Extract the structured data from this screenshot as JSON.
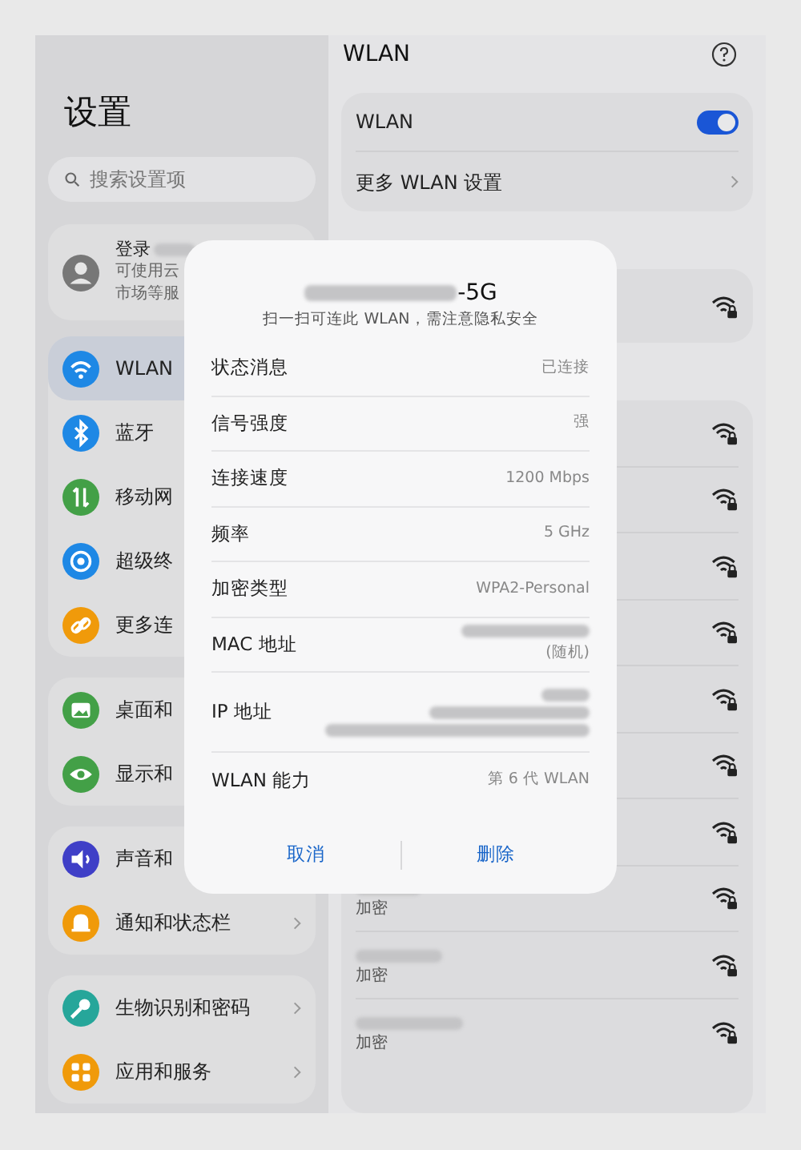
{
  "sidebar": {
    "title": "设置",
    "search": {
      "placeholder": "搜索设置项"
    },
    "account": {
      "title": "登录",
      "lines": [
        "可使用云",
        "市场等服"
      ]
    },
    "groups": [
      [
        {
          "label": "WLAN",
          "color": "#1e88e5",
          "selected": true
        },
        {
          "label": "蓝牙",
          "color": "#1e88e5",
          "selected": false
        },
        {
          "label": "移动网",
          "color": "#43a047",
          "selected": false
        },
        {
          "label": "超级终",
          "color": "#1e88e5",
          "selected": false
        },
        {
          "label": "更多连",
          "color": "#f09a0a",
          "selected": false
        }
      ],
      [
        {
          "label": "桌面和",
          "color": "#43a047",
          "selected": false
        },
        {
          "label": "显示和",
          "color": "#43a047",
          "selected": false
        }
      ],
      [
        {
          "label": "声音和",
          "color": "#3f3fc7",
          "selected": false
        },
        {
          "label": "通知和状态栏",
          "color": "#f09a0a",
          "selected": false,
          "chevron": true
        }
      ],
      [
        {
          "label": "生物识别和密码",
          "color": "#26a69a",
          "selected": false,
          "chevron": true
        },
        {
          "label": "应用和服务",
          "color": "#f09a0a",
          "selected": false,
          "chevron": true
        }
      ]
    ]
  },
  "main": {
    "title": "WLAN",
    "wlan_toggle": {
      "label": "WLAN",
      "on": true
    },
    "more_settings": "更多 WLAN 设置",
    "networks": [
      {
        "kind": "covered"
      },
      {
        "kind": "covered"
      },
      {
        "kind": "covered"
      },
      {
        "kind": "covered"
      },
      {
        "kind": "covered"
      },
      {
        "kind": "covered"
      },
      {
        "kind": "covered"
      },
      {
        "kind": "listed",
        "subtitle": "加密"
      },
      {
        "kind": "listed",
        "subtitle": "加密"
      },
      {
        "kind": "listed",
        "subtitle": "加密"
      }
    ]
  },
  "dialog": {
    "title": "-5G",
    "subtitle": "扫一扫可连此 WLAN，需注意隐私安全",
    "rows": [
      {
        "label": "状态消息",
        "value": "已连接"
      },
      {
        "label": "信号强度",
        "value": "强"
      },
      {
        "label": "连接速度",
        "value": "1200 Mbps"
      },
      {
        "label": "频率",
        "value": "5 GHz"
      },
      {
        "label": "加密类型",
        "value": "WPA2-Personal"
      },
      {
        "label": "MAC 地址",
        "value": "(随机)",
        "blurred": true
      },
      {
        "label": "IP 地址",
        "blurred": true
      },
      {
        "label": "WLAN 能力",
        "value": "第 6 代 WLAN"
      }
    ],
    "buttons": [
      "取消",
      "删除"
    ]
  }
}
